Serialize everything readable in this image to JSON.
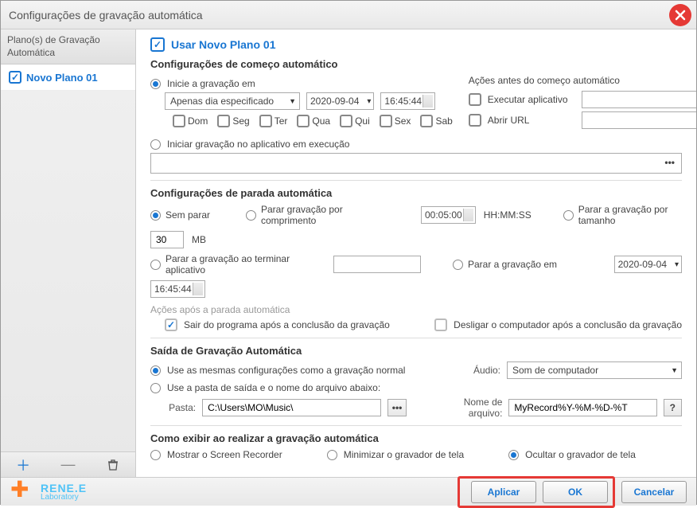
{
  "window": {
    "title": "Configurações de gravação automática"
  },
  "sidebar": {
    "header": "Plano(s) de Gravação Automática",
    "plans": [
      {
        "label": "Novo Plano 01",
        "checked": true
      }
    ]
  },
  "plan": {
    "use_label": "Usar Novo Plano 01",
    "start": {
      "section": "Configurações de começo automático",
      "opt_start_at": "Inicie a gravação em",
      "frequency": "Apenas dia especificado",
      "date": "2020-09-04",
      "time": "16:45:44",
      "days": {
        "dom": "Dom",
        "seg": "Seg",
        "ter": "Ter",
        "qua": "Qua",
        "qui": "Qui",
        "sex": "Sex",
        "sab": "Sab"
      },
      "opt_running_app": "Iniciar gravação no aplicativo em execução",
      "actions_title": "Ações antes do começo automático",
      "run_app": "Executar aplicativo",
      "open_url": "Abrir URL"
    },
    "stop": {
      "section": "Configurações de parada automática",
      "opt_nonstop": "Sem parar",
      "opt_duration": "Parar gravação por comprimento",
      "duration": "00:05:00",
      "hhmmss": "HH:MM:SS",
      "opt_size": "Parar a gravação por tamanho",
      "size_value": "30",
      "size_unit": "MB",
      "opt_app_end": "Parar a gravação ao terminar aplicativo",
      "opt_stop_at": "Parar a gravação em",
      "stop_date": "2020-09-04",
      "stop_time": "16:45:44",
      "after_title": "Ações após a parada automática",
      "exit_program": "Sair do programa após a conclusão da gravação",
      "shutdown": "Desligar o computador após a conclusão da gravação"
    },
    "output": {
      "section": "Saída de Gravação Automática",
      "opt_same": "Use as mesmas configurações como a gravação normal",
      "audio_label": "Áudio:",
      "audio_value": "Som de computador",
      "opt_custom": "Use a pasta de saída e o nome do arquivo abaixo:",
      "folder_label": "Pasta:",
      "folder_value": "C:\\Users\\MO\\Music\\",
      "filename_label": "Nome de arquivo:",
      "filename_value": "MyRecord%Y-%M-%D-%T"
    },
    "display": {
      "section": "Como exibir ao realizar a gravação automática",
      "opt_show": "Mostrar o Screen Recorder",
      "opt_min": "Minimizar o gravador de tela",
      "opt_hide": "Ocultar o gravador de tela"
    }
  },
  "logo": {
    "line1": "RENE.E",
    "line2": "Laboratory"
  },
  "buttons": {
    "apply": "Aplicar",
    "ok": "OK",
    "cancel": "Cancelar"
  }
}
